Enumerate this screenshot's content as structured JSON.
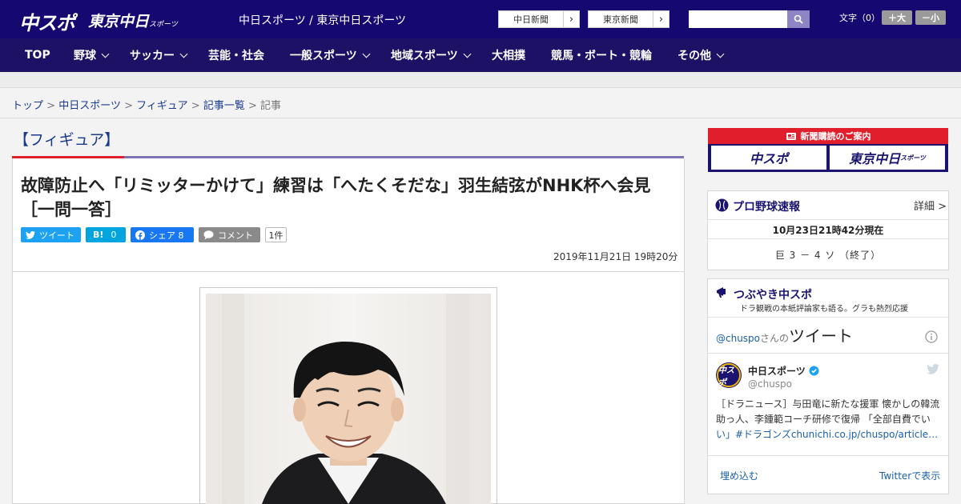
{
  "header": {
    "logo_chuspo": "中スポ",
    "logo_tokyo": "東京中日",
    "logo_tokyo_small": "スポーツ",
    "site_names": "中日スポーツ / 東京中日スポーツ",
    "ext_links": [
      {
        "label": "中日新聞"
      },
      {
        "label": "東京新聞"
      }
    ],
    "font_size_label": "文字（0）",
    "font_plus": "＋大",
    "font_minus": "－小"
  },
  "nav": {
    "items": [
      {
        "label": "TOP",
        "dropdown": false
      },
      {
        "label": "野球",
        "dropdown": true
      },
      {
        "label": "サッカー",
        "dropdown": true
      },
      {
        "label": "芸能・社会",
        "dropdown": false
      },
      {
        "label": "一般スポーツ",
        "dropdown": true
      },
      {
        "label": "地域スポーツ",
        "dropdown": true
      },
      {
        "label": "大相撲",
        "dropdown": false
      },
      {
        "label": "競馬・ボート・競輪",
        "dropdown": false
      },
      {
        "label": "その他",
        "dropdown": true
      }
    ]
  },
  "breadcrumb": {
    "items": [
      "トップ",
      "中日スポーツ",
      "フィギュア",
      "記事一覧"
    ],
    "current": "記事",
    "separator": ">"
  },
  "article": {
    "category": "【フィギュア】",
    "headline": "故障防止へ「リミッターかけて」練習は「へたくそだな」羽生結弦がNHK杯へ会見［一問一答］",
    "share": {
      "tweet": "ツイート",
      "hatena_count": "0",
      "facebook": "シェア 8",
      "comment": "コメント",
      "comment_count": "1件"
    },
    "datetime": "2019年11月21日 19時20分"
  },
  "sidebar": {
    "subscribe_title": "新聞購読のご案内",
    "subscribe_logos": [
      "中スポ",
      "東京中日"
    ],
    "subscribe_logo_small": "スポーツ",
    "baseball": {
      "title": "プロ野球速報",
      "detail": "詳細 >",
      "timestamp": "10月23日21時42分現在",
      "score": "巨 3 － 4 ソ （終了）"
    },
    "tsubuyaki": {
      "title": "つぶやき中スポ",
      "subtitle": "ドラ観戦の本紙評論家も語る。グラも熱烈応援",
      "tweets_by_handle": "@chuspo",
      "tweets_by_suffix": "さんの",
      "tweets_by_word": "ツイート",
      "account_name": "中日スポーツ",
      "account_handle": "@chuspo",
      "tweet_text": "［ドラニュース］与田竜に新たな援軍 懐かしの韓流助っ人、李鍾範コーチ研修で復帰 「全部自費でい",
      "tweet_text_hash": "い」#ドラゴンズchunichi.co.jp/chuspo/article…",
      "embed": "埋め込む",
      "view_on_twitter": "Twitterで表示"
    }
  },
  "colors": {
    "header_bg": "#150870",
    "nav_bg": "#1d1166",
    "accent_red": "#e01e2c",
    "link_blue": "#1a3a8c",
    "twitter": "#1da1f2",
    "hatena": "#00a4de",
    "facebook": "#1877f2"
  }
}
